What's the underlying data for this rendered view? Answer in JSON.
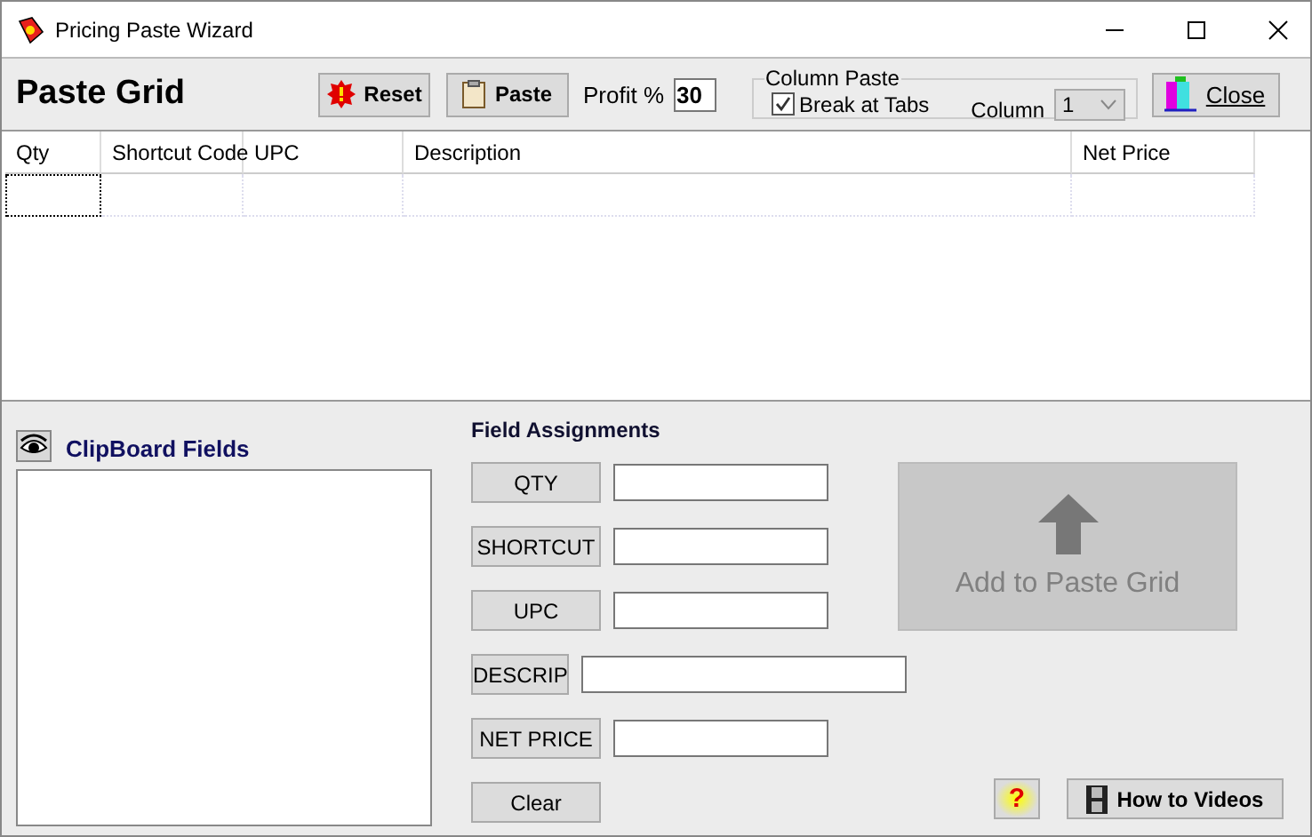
{
  "window": {
    "title": "Pricing Paste Wizard"
  },
  "toolbar": {
    "heading": "Paste Grid",
    "reset_button": "Reset",
    "paste_button": "Paste",
    "profit_label": "Profit %",
    "profit_value": "30",
    "column_paste": {
      "legend": "Column Paste",
      "break_at_tabs": {
        "label": "Break at Tabs",
        "checked": true
      },
      "column_label": "Column",
      "column_value": "1"
    },
    "close_button": "Close"
  },
  "grid": {
    "columns": [
      "Qty",
      "Shortcut Code",
      "UPC",
      "Description",
      "Net Price"
    ]
  },
  "clipboard": {
    "title": "ClipBoard Fields"
  },
  "field_assignments": {
    "title": "Field Assignments",
    "fields": [
      {
        "label": "QTY",
        "kind": "short"
      },
      {
        "label": "SHORTCUT",
        "kind": "short"
      },
      {
        "label": "UPC",
        "kind": "short"
      },
      {
        "label": "DESCRIP",
        "kind": "long"
      },
      {
        "label": "NET PRICE",
        "kind": "short"
      }
    ],
    "clear_button": "Clear"
  },
  "add_button": {
    "label": "Add to Paste Grid",
    "disabled": true
  },
  "help_button": "?",
  "videos_button": "How to Videos"
}
